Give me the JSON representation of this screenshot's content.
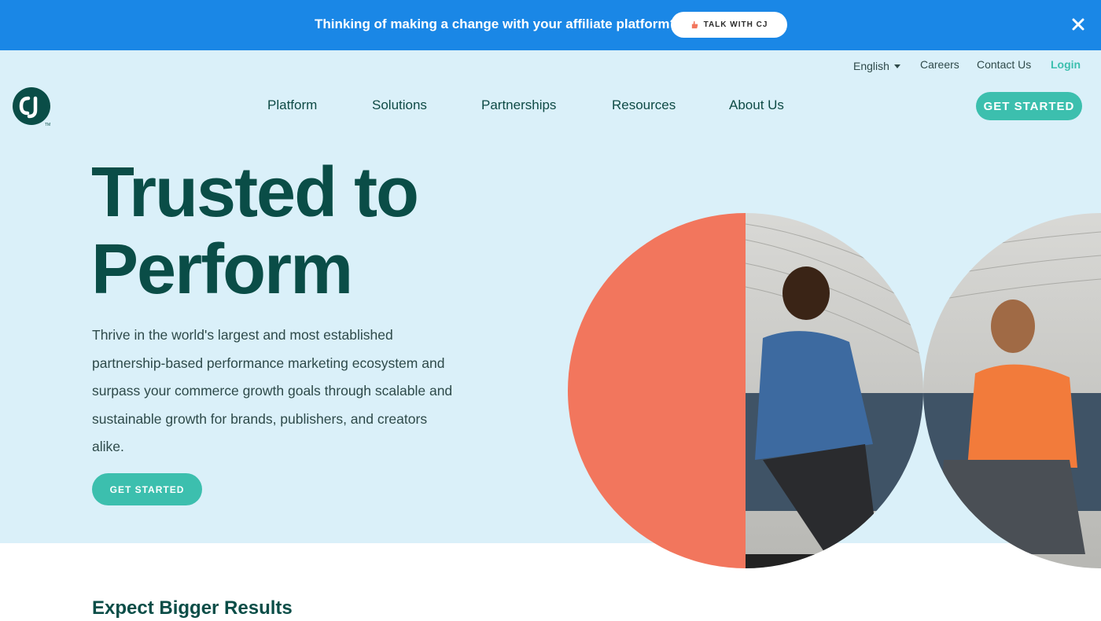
{
  "banner": {
    "message": "Thinking of making a change with your affiliate platform?",
    "button_label": "TALK WITH CJ",
    "button_icon": "hand-point-icon",
    "close_icon": "close-icon"
  },
  "utility_nav": {
    "language": "English",
    "careers": "Careers",
    "contact": "Contact Us",
    "login": "Login"
  },
  "logo": {
    "text": "CJ",
    "trademark": "TM"
  },
  "main_nav": {
    "items": [
      {
        "label": "Platform"
      },
      {
        "label": "Solutions"
      },
      {
        "label": "Partnerships"
      },
      {
        "label": "Resources"
      },
      {
        "label": "About Us"
      }
    ],
    "cta": "GET STARTED"
  },
  "hero": {
    "title_line1": "Trusted to",
    "title_line2": "Perform",
    "description": "Thrive in the world's largest and most established partnership-based performance marketing ecosystem and surpass your commerce growth goals through scalable and sustainable growth for brands, publishers, and creators alike.",
    "cta": "GET STARTED"
  },
  "section": {
    "heading": "Expect Bigger Results"
  },
  "colors": {
    "banner_bg": "#1a87e6",
    "hero_bg": "#daf0f9",
    "brand_dark": "#0a4d47",
    "accent_teal": "#3cbfae",
    "coral": "#f2765d"
  }
}
